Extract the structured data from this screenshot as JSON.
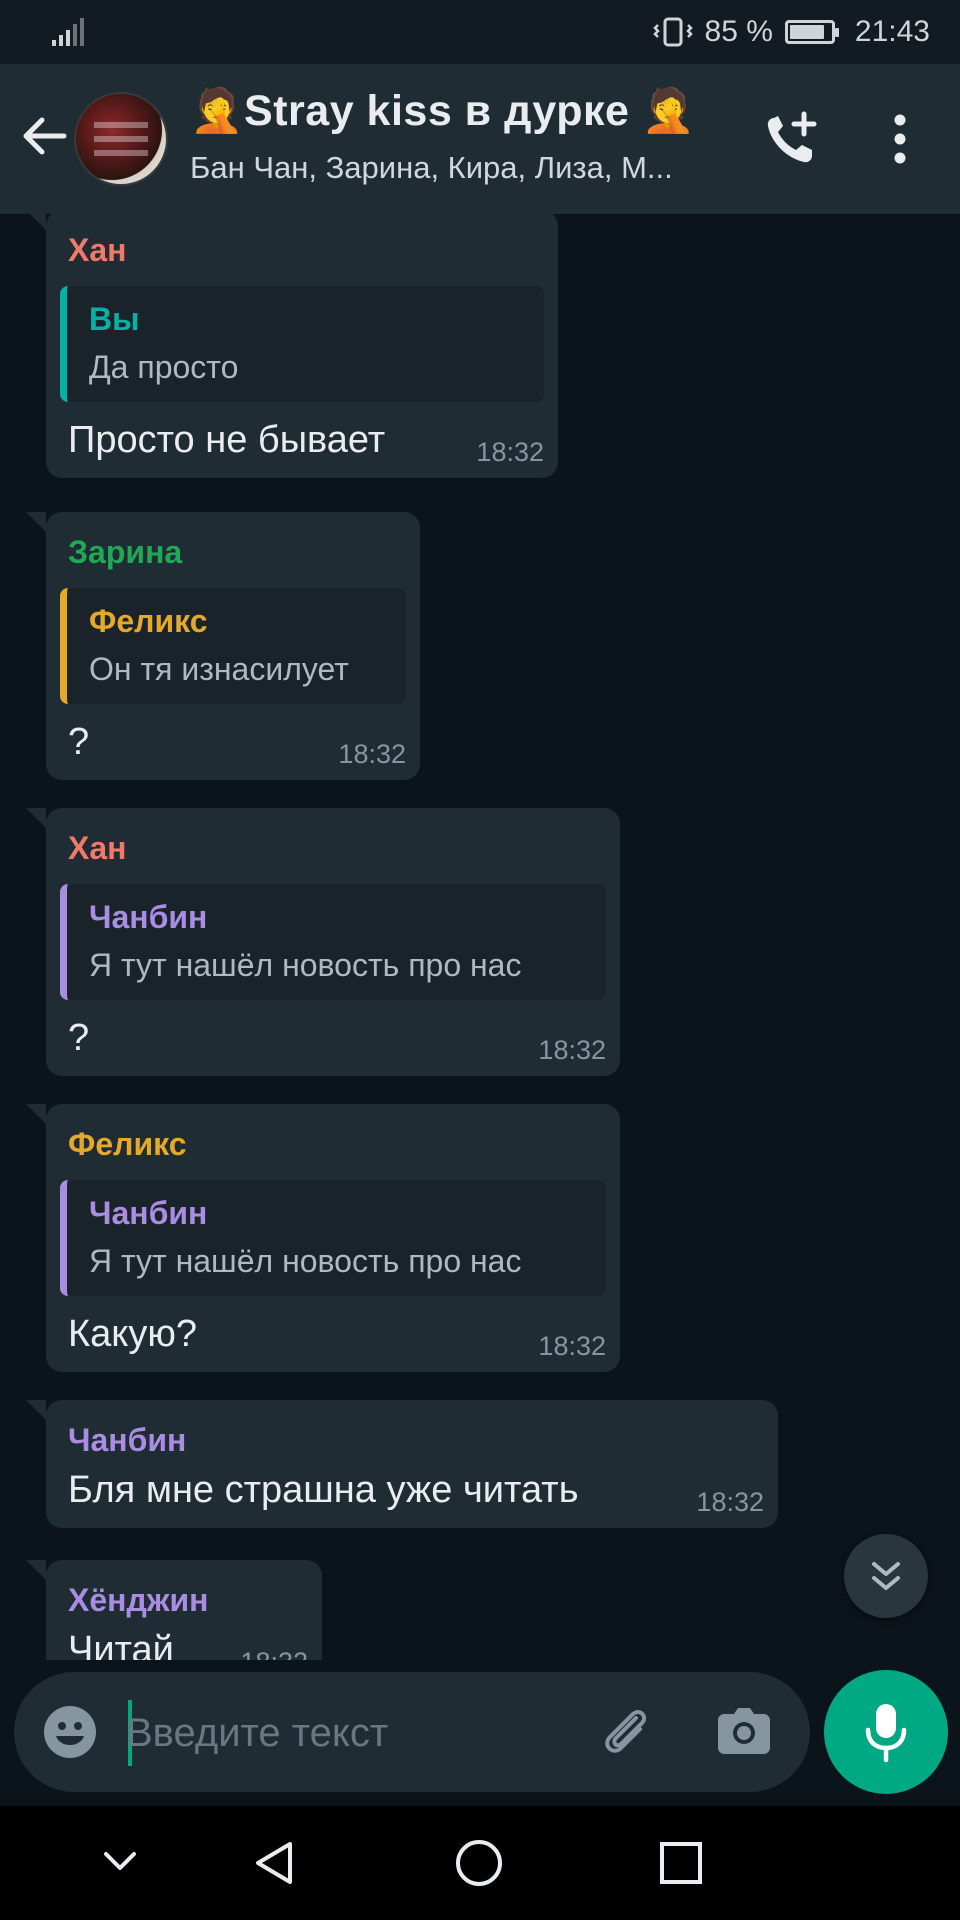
{
  "status_bar": {
    "battery_text": "85 %",
    "battery_level": 0.85,
    "time": "21:43"
  },
  "header": {
    "title": "🤦Stray kiss в дурке 🤦",
    "subtitle": "Бан Чан, Зарина, Кира, Лиза, М..."
  },
  "messages": [
    {
      "sender": "Хан",
      "sender_color": "#f07a6a",
      "quote_name": "Вы",
      "quote_text": "Да просто",
      "quote_color": "#06b2a6",
      "text": "Просто не бывает",
      "time": "18:32"
    },
    {
      "sender": "Зарина",
      "sender_color": "#1fa855",
      "quote_name": "Феликс",
      "quote_text": "Он тя изнасилует",
      "quote_color": "#e5a92a",
      "text": "?",
      "time": "18:32"
    },
    {
      "sender": "Хан",
      "sender_color": "#f07a6a",
      "quote_name": "Чанбин",
      "quote_text": "Я тут нашёл новость про нас",
      "quote_color": "#a98de3",
      "text": "?",
      "time": "18:32"
    },
    {
      "sender": "Феликс",
      "sender_color": "#e5a92a",
      "quote_name": "Чанбин",
      "quote_text": "Я тут нашёл новость про нас",
      "quote_color": "#a98de3",
      "text": "Какую?",
      "time": "18:32"
    },
    {
      "sender": "Чанбин",
      "sender_color": "#a98de3",
      "text": "Бля мне страшна уже читать",
      "time": "18:32"
    },
    {
      "sender": "Хёнджин",
      "sender_color": "#a98de3",
      "text": "Читай",
      "time": "18:32"
    }
  ],
  "input": {
    "placeholder": "Введите текст"
  },
  "icons": {
    "back": "arrow-left-icon",
    "call": "add-call-icon",
    "menu": "more-vertical-icon",
    "emoji": "emoji-icon",
    "attach": "paperclip-icon",
    "camera": "camera-icon",
    "mic": "microphone-icon",
    "scroll": "chevron-double-down-icon"
  }
}
